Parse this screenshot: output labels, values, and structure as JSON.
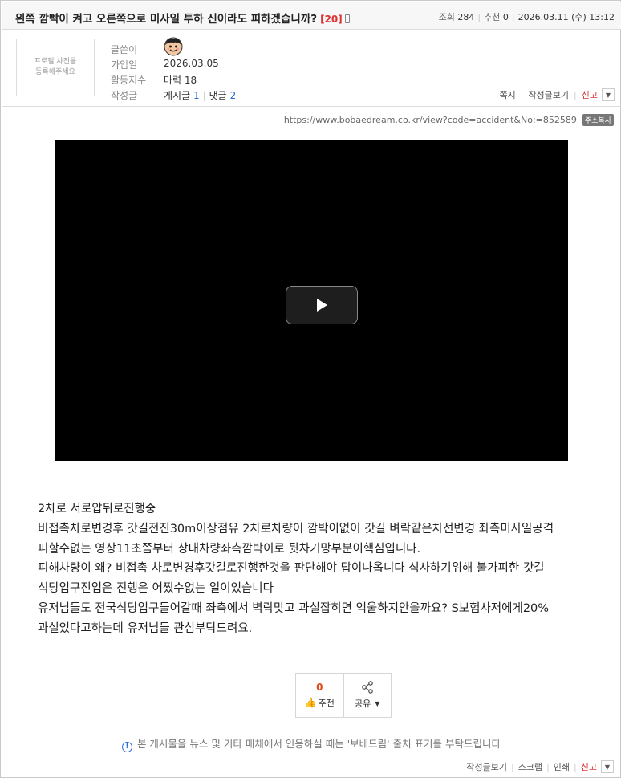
{
  "post": {
    "title": "왼쪽 깜빡이 켜고 오른쪽으로 미사일 투하 신이라도 피하겠습니까?",
    "reply_count": "[20]",
    "views_label": "조회",
    "views": "284",
    "recommend_label": "추천",
    "recommend": "0",
    "datetime": "2026.03.11 (수) 13:12"
  },
  "author": {
    "profile_placeholder_line1": "프로필 사진을",
    "profile_placeholder_line2": "등록해주세요",
    "writer_label": "글쓴이",
    "joined_label": "가입일",
    "joined": "2026.03.05",
    "activity_label": "활동지수",
    "activity": "마력 18",
    "posts_label": "작성글",
    "posts_text": "게시글",
    "posts_count": "1",
    "comments_text": "댓글",
    "comments_count": "2",
    "actions": {
      "message": "쪽지",
      "view_posts": "작성글보기",
      "report": "신고"
    }
  },
  "url": {
    "text": "https://www.bobaedream.co.kr/view?code=accident&No;=852589",
    "copy_label": "주소복사"
  },
  "body": {
    "lines": [
      "2차로 서로압뒤로진행중",
      "비접촉차로변경후 갓길전진30m이상점유 2차로차량이 깜박이없이 갓길 벼락같은차선변경 좌측미사일공격",
      "피할수없는 영상11초쯤부터 상대차량좌측깜박이로 뒷차기망부분이핵심입니다.",
      "피해차량이 왜? 비접촉 차로변경후갓길로진행한것을 판단해야 답이나옵니다 식사하기위해 불가피한 갓길",
      "식당입구진입은 진행은 어쩠수없는 일이었습니다",
      "유저님들도 전국식당입구들어갈때 좌측에서 벽락맞고 과실잡히면 억울하지안을까요? S보험사저에게20%",
      "과실있다고하는데 유저님들 관심부탁드려요."
    ]
  },
  "vote": {
    "count": "0",
    "recommend_label": "추천",
    "share_label": "공유"
  },
  "notice": "본 게시물을 뉴스 및 기타 매체에서 인용하실 때는 '보배드림' 출처 표기를 부탁드립니다",
  "bottom_actions": {
    "view_posts": "작성글보기",
    "scrap": "스크랩",
    "print": "인쇄",
    "report": "신고"
  },
  "colors": {
    "accent_red": "#d33333",
    "link_blue": "#2b6fd6",
    "vote_orange": "#e24a1a"
  }
}
